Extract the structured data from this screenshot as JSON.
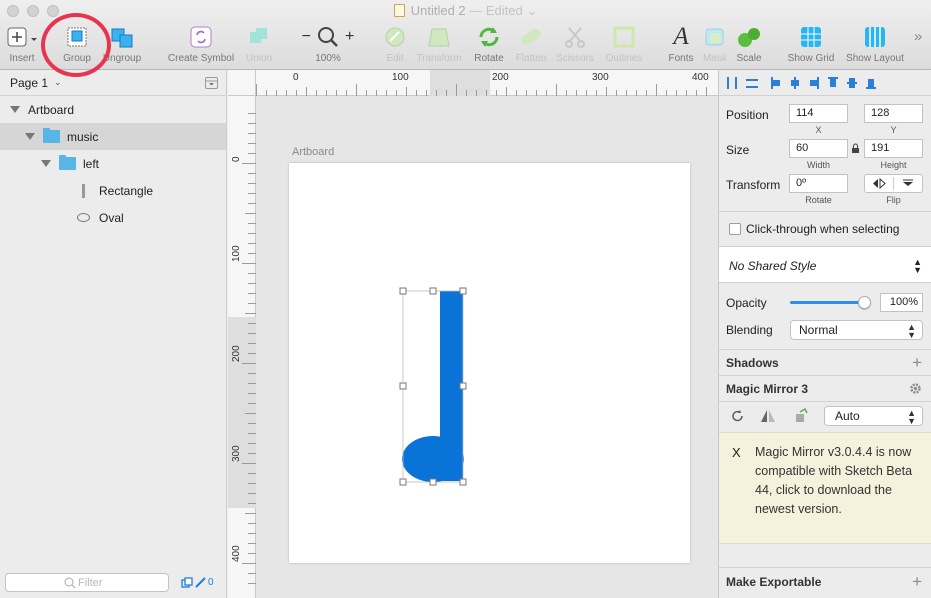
{
  "window": {
    "title": "Untitled 2",
    "status": "— Edited"
  },
  "toolbar": {
    "items": [
      {
        "label": "Insert"
      },
      {
        "label": "Group"
      },
      {
        "label": "Ungroup"
      },
      {
        "label": "Create Symbol"
      },
      {
        "label": "Union"
      },
      {
        "label": "100%"
      },
      {
        "label": "Edit"
      },
      {
        "label": "Transform"
      },
      {
        "label": "Rotate"
      },
      {
        "label": "Flatten"
      },
      {
        "label": "Scissors"
      },
      {
        "label": "Outlines"
      },
      {
        "label": "Fonts"
      },
      {
        "label": "Mask"
      },
      {
        "label": "Scale"
      },
      {
        "label": "Show Grid"
      },
      {
        "label": "Show Layout"
      }
    ],
    "zoom_minus": "−",
    "zoom_plus": "+",
    "overflow": "»"
  },
  "layers": {
    "page": "Page 1",
    "items": [
      {
        "name": "Artboard"
      },
      {
        "name": "music"
      },
      {
        "name": "left"
      },
      {
        "name": "Rectangle"
      },
      {
        "name": "Oval"
      }
    ],
    "filter_placeholder": "Filter",
    "filter_count": "0"
  },
  "canvas": {
    "artboard_label": "Artboard",
    "ruler_top": [
      "0",
      "100",
      "200",
      "300",
      "400"
    ],
    "ruler_left": [
      "0",
      "100",
      "200",
      "300",
      "400"
    ],
    "shape_color": "#0A73D8"
  },
  "inspector": {
    "position_label": "Position",
    "x_value": "114",
    "y_value": "128",
    "x_label": "X",
    "y_label": "Y",
    "size_label": "Size",
    "width_value": "60",
    "height_value": "191",
    "width_label": "Width",
    "height_label": "Height",
    "transform_label": "Transform",
    "rotate_value": "0º",
    "rotate_label": "Rotate",
    "flip_label": "Flip",
    "clickthrough_label": "Click-through when selecting",
    "shared_style": "No Shared Style",
    "opacity_label": "Opacity",
    "opacity_value": "100%",
    "opacity_level": 1.0,
    "blending_label": "Blending",
    "blending_value": "Normal",
    "shadows_label": "Shadows",
    "magic_mirror_label": "Magic Mirror 3",
    "magic_mode": "Auto",
    "notice_x": "X",
    "notice_text": "Magic Mirror v3.0.4.4 is now compatible with Sketch Beta 44, click to download the newest version.",
    "make_exportable_label": "Make Exportable"
  }
}
